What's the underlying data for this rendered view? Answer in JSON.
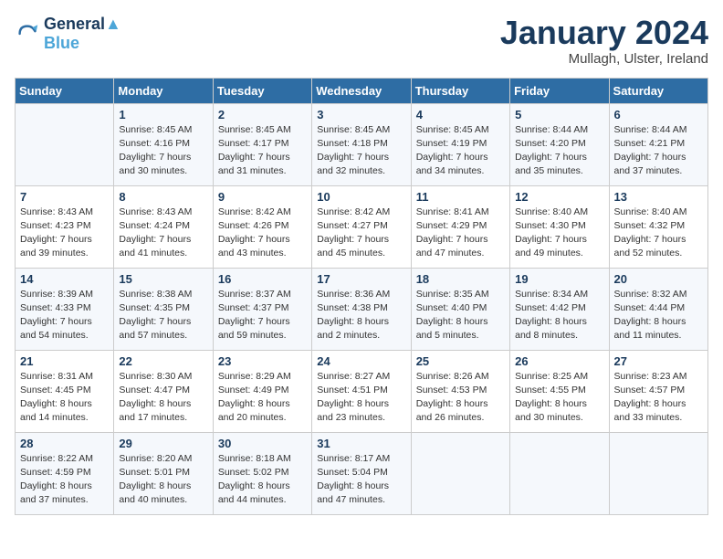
{
  "header": {
    "logo_line1": "General",
    "logo_line2": "Blue",
    "month": "January 2024",
    "location": "Mullagh, Ulster, Ireland"
  },
  "weekdays": [
    "Sunday",
    "Monday",
    "Tuesday",
    "Wednesday",
    "Thursday",
    "Friday",
    "Saturday"
  ],
  "weeks": [
    [
      {
        "day": "",
        "sunrise": "",
        "sunset": "",
        "daylight": ""
      },
      {
        "day": "1",
        "sunrise": "Sunrise: 8:45 AM",
        "sunset": "Sunset: 4:16 PM",
        "daylight": "Daylight: 7 hours and 30 minutes."
      },
      {
        "day": "2",
        "sunrise": "Sunrise: 8:45 AM",
        "sunset": "Sunset: 4:17 PM",
        "daylight": "Daylight: 7 hours and 31 minutes."
      },
      {
        "day": "3",
        "sunrise": "Sunrise: 8:45 AM",
        "sunset": "Sunset: 4:18 PM",
        "daylight": "Daylight: 7 hours and 32 minutes."
      },
      {
        "day": "4",
        "sunrise": "Sunrise: 8:45 AM",
        "sunset": "Sunset: 4:19 PM",
        "daylight": "Daylight: 7 hours and 34 minutes."
      },
      {
        "day": "5",
        "sunrise": "Sunrise: 8:44 AM",
        "sunset": "Sunset: 4:20 PM",
        "daylight": "Daylight: 7 hours and 35 minutes."
      },
      {
        "day": "6",
        "sunrise": "Sunrise: 8:44 AM",
        "sunset": "Sunset: 4:21 PM",
        "daylight": "Daylight: 7 hours and 37 minutes."
      }
    ],
    [
      {
        "day": "7",
        "sunrise": "Sunrise: 8:43 AM",
        "sunset": "Sunset: 4:23 PM",
        "daylight": "Daylight: 7 hours and 39 minutes."
      },
      {
        "day": "8",
        "sunrise": "Sunrise: 8:43 AM",
        "sunset": "Sunset: 4:24 PM",
        "daylight": "Daylight: 7 hours and 41 minutes."
      },
      {
        "day": "9",
        "sunrise": "Sunrise: 8:42 AM",
        "sunset": "Sunset: 4:26 PM",
        "daylight": "Daylight: 7 hours and 43 minutes."
      },
      {
        "day": "10",
        "sunrise": "Sunrise: 8:42 AM",
        "sunset": "Sunset: 4:27 PM",
        "daylight": "Daylight: 7 hours and 45 minutes."
      },
      {
        "day": "11",
        "sunrise": "Sunrise: 8:41 AM",
        "sunset": "Sunset: 4:29 PM",
        "daylight": "Daylight: 7 hours and 47 minutes."
      },
      {
        "day": "12",
        "sunrise": "Sunrise: 8:40 AM",
        "sunset": "Sunset: 4:30 PM",
        "daylight": "Daylight: 7 hours and 49 minutes."
      },
      {
        "day": "13",
        "sunrise": "Sunrise: 8:40 AM",
        "sunset": "Sunset: 4:32 PM",
        "daylight": "Daylight: 7 hours and 52 minutes."
      }
    ],
    [
      {
        "day": "14",
        "sunrise": "Sunrise: 8:39 AM",
        "sunset": "Sunset: 4:33 PM",
        "daylight": "Daylight: 7 hours and 54 minutes."
      },
      {
        "day": "15",
        "sunrise": "Sunrise: 8:38 AM",
        "sunset": "Sunset: 4:35 PM",
        "daylight": "Daylight: 7 hours and 57 minutes."
      },
      {
        "day": "16",
        "sunrise": "Sunrise: 8:37 AM",
        "sunset": "Sunset: 4:37 PM",
        "daylight": "Daylight: 7 hours and 59 minutes."
      },
      {
        "day": "17",
        "sunrise": "Sunrise: 8:36 AM",
        "sunset": "Sunset: 4:38 PM",
        "daylight": "Daylight: 8 hours and 2 minutes."
      },
      {
        "day": "18",
        "sunrise": "Sunrise: 8:35 AM",
        "sunset": "Sunset: 4:40 PM",
        "daylight": "Daylight: 8 hours and 5 minutes."
      },
      {
        "day": "19",
        "sunrise": "Sunrise: 8:34 AM",
        "sunset": "Sunset: 4:42 PM",
        "daylight": "Daylight: 8 hours and 8 minutes."
      },
      {
        "day": "20",
        "sunrise": "Sunrise: 8:32 AM",
        "sunset": "Sunset: 4:44 PM",
        "daylight": "Daylight: 8 hours and 11 minutes."
      }
    ],
    [
      {
        "day": "21",
        "sunrise": "Sunrise: 8:31 AM",
        "sunset": "Sunset: 4:45 PM",
        "daylight": "Daylight: 8 hours and 14 minutes."
      },
      {
        "day": "22",
        "sunrise": "Sunrise: 8:30 AM",
        "sunset": "Sunset: 4:47 PM",
        "daylight": "Daylight: 8 hours and 17 minutes."
      },
      {
        "day": "23",
        "sunrise": "Sunrise: 8:29 AM",
        "sunset": "Sunset: 4:49 PM",
        "daylight": "Daylight: 8 hours and 20 minutes."
      },
      {
        "day": "24",
        "sunrise": "Sunrise: 8:27 AM",
        "sunset": "Sunset: 4:51 PM",
        "daylight": "Daylight: 8 hours and 23 minutes."
      },
      {
        "day": "25",
        "sunrise": "Sunrise: 8:26 AM",
        "sunset": "Sunset: 4:53 PM",
        "daylight": "Daylight: 8 hours and 26 minutes."
      },
      {
        "day": "26",
        "sunrise": "Sunrise: 8:25 AM",
        "sunset": "Sunset: 4:55 PM",
        "daylight": "Daylight: 8 hours and 30 minutes."
      },
      {
        "day": "27",
        "sunrise": "Sunrise: 8:23 AM",
        "sunset": "Sunset: 4:57 PM",
        "daylight": "Daylight: 8 hours and 33 minutes."
      }
    ],
    [
      {
        "day": "28",
        "sunrise": "Sunrise: 8:22 AM",
        "sunset": "Sunset: 4:59 PM",
        "daylight": "Daylight: 8 hours and 37 minutes."
      },
      {
        "day": "29",
        "sunrise": "Sunrise: 8:20 AM",
        "sunset": "Sunset: 5:01 PM",
        "daylight": "Daylight: 8 hours and 40 minutes."
      },
      {
        "day": "30",
        "sunrise": "Sunrise: 8:18 AM",
        "sunset": "Sunset: 5:02 PM",
        "daylight": "Daylight: 8 hours and 44 minutes."
      },
      {
        "day": "31",
        "sunrise": "Sunrise: 8:17 AM",
        "sunset": "Sunset: 5:04 PM",
        "daylight": "Daylight: 8 hours and 47 minutes."
      },
      {
        "day": "",
        "sunrise": "",
        "sunset": "",
        "daylight": ""
      },
      {
        "day": "",
        "sunrise": "",
        "sunset": "",
        "daylight": ""
      },
      {
        "day": "",
        "sunrise": "",
        "sunset": "",
        "daylight": ""
      }
    ]
  ]
}
